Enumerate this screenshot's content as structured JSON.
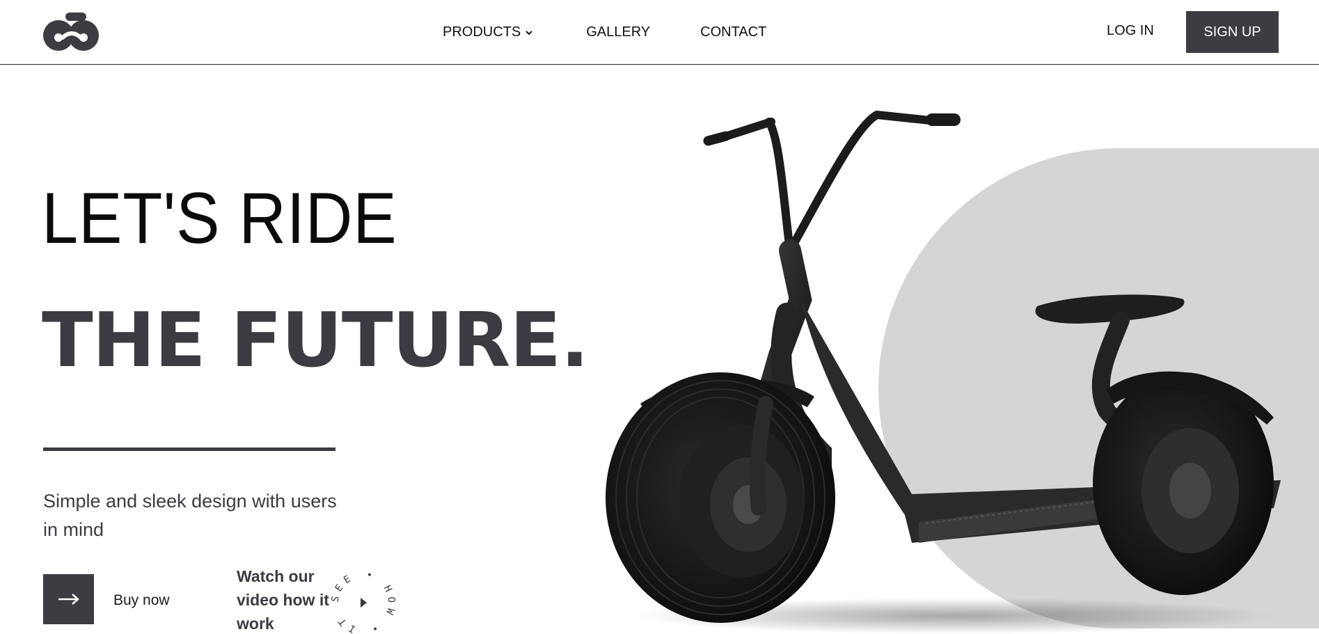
{
  "header": {
    "logo_icon": "bike-logo-icon",
    "nav": [
      {
        "label": "PRODUCTS",
        "has_dropdown": true
      },
      {
        "label": "GALLERY"
      },
      {
        "label": "CONTACT"
      }
    ],
    "login_label": "LOG IN",
    "signup_label": "SIGN UP"
  },
  "hero": {
    "line1": "LET'S RIDE",
    "line2": "THE FUTURE.",
    "subtitle": "Simple and sleek design with users in mind",
    "buy_label": "Buy now",
    "watch_text": "Watch our video how it work",
    "badge_text": "SEE • HOW • IT • WORKS •"
  },
  "colors": {
    "accent": "#3b3d42",
    "gray_shape": "#d5d5d5"
  }
}
